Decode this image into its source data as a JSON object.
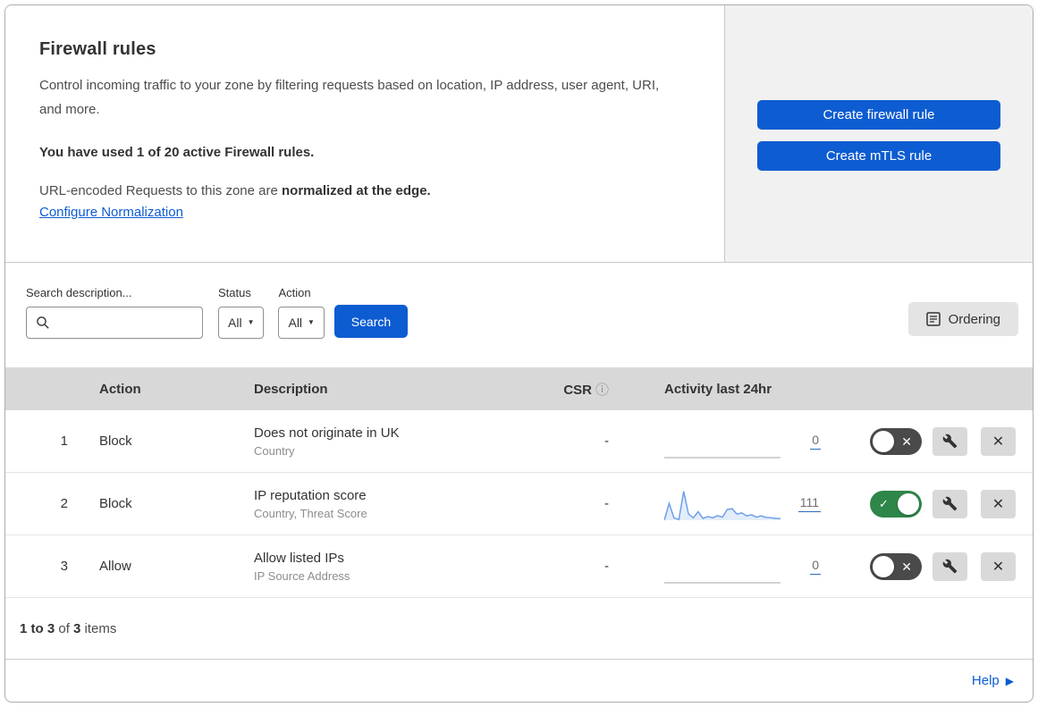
{
  "header": {
    "title": "Firewall rules",
    "description": "Control incoming traffic to your zone by filtering requests based on location, IP address, user agent, URI, and more.",
    "usage_text": "You have used 1 of 20 active Firewall rules.",
    "normalization_prefix": "URL-encoded Requests to this zone are ",
    "normalization_bold": "normalized at the edge.",
    "normalization_link": "Configure Normalization"
  },
  "actions_panel": {
    "create_firewall_rule_label": "Create firewall rule",
    "create_mtls_rule_label": "Create mTLS rule"
  },
  "filters": {
    "search_label": "Search description...",
    "search_value": "",
    "status_label": "Status",
    "status_value": "All",
    "action_label": "Action",
    "action_value": "All",
    "search_button_label": "Search",
    "ordering_button_label": "Ordering"
  },
  "table": {
    "columns": {
      "action": "Action",
      "description": "Description",
      "csr": "CSR",
      "activity": "Activity last 24hr"
    },
    "rows": [
      {
        "priority": "1",
        "action": "Block",
        "description": "Does not originate in UK",
        "criteria": "Country",
        "csr": "-",
        "activity_count": "0",
        "enabled": false
      },
      {
        "priority": "2",
        "action": "Block",
        "description": "IP reputation score",
        "criteria": "Country, Threat Score",
        "csr": "-",
        "activity_count": "111",
        "enabled": true
      },
      {
        "priority": "3",
        "action": "Allow",
        "description": "Allow listed IPs",
        "criteria": "IP Source Address",
        "csr": "-",
        "activity_count": "0",
        "enabled": false
      }
    ]
  },
  "footer": {
    "range_bold": "1 to 3",
    "of_text": " of ",
    "total_bold": "3",
    "items_text": " items",
    "help_label": "Help"
  },
  "icons": {
    "toggle_on": "✓",
    "toggle_off": "✕",
    "delete": "✕",
    "dropdown_arrow": "▼",
    "info": "ⓘ",
    "help_arrow": "▶"
  },
  "colors": {
    "accent_blue": "#0d5cd1",
    "link_blue": "#0d5cd1",
    "toggle_on_green": "#2f8649",
    "toggle_off_gray": "#4a4a4a",
    "panel_gray": "#f1f1f1",
    "table_header_gray": "#d8d8d8",
    "icon_button_gray": "#d9d9d9",
    "sparkline_blue": "#6f9fe8",
    "sparkline_fill": "#e3edfa"
  },
  "chart_data": [
    {
      "type": "line",
      "title": "Rule 1 activity last 24hr (Does not originate in UK)",
      "values": [
        0,
        0,
        0,
        0,
        0,
        0,
        0,
        0,
        0,
        0,
        0,
        0,
        0,
        0,
        0,
        0,
        0,
        0,
        0,
        0,
        0,
        0,
        0,
        0,
        0
      ],
      "total_label": "0",
      "ylim": [
        0,
        100
      ],
      "note": "flat zero sparkline, no axes or labels shown"
    },
    {
      "type": "line",
      "title": "Rule 2 activity last 24hr (IP reputation score)",
      "values": [
        0,
        55,
        8,
        2,
        95,
        20,
        8,
        28,
        6,
        12,
        8,
        15,
        10,
        35,
        38,
        20,
        24,
        14,
        18,
        10,
        14,
        9,
        8,
        6,
        5
      ],
      "total_label": "111",
      "ylim": [
        0,
        100
      ],
      "note": "relative heights estimated from unlabeled sparkline"
    },
    {
      "type": "line",
      "title": "Rule 3 activity last 24hr (Allow listed IPs)",
      "values": [
        0,
        0,
        0,
        0,
        0,
        0,
        0,
        0,
        0,
        0,
        0,
        0,
        0,
        0,
        0,
        0,
        0,
        0,
        0,
        0,
        0,
        0,
        0,
        0,
        0
      ],
      "total_label": "0",
      "ylim": [
        0,
        100
      ],
      "note": "flat zero sparkline, no axes or labels shown"
    }
  ]
}
